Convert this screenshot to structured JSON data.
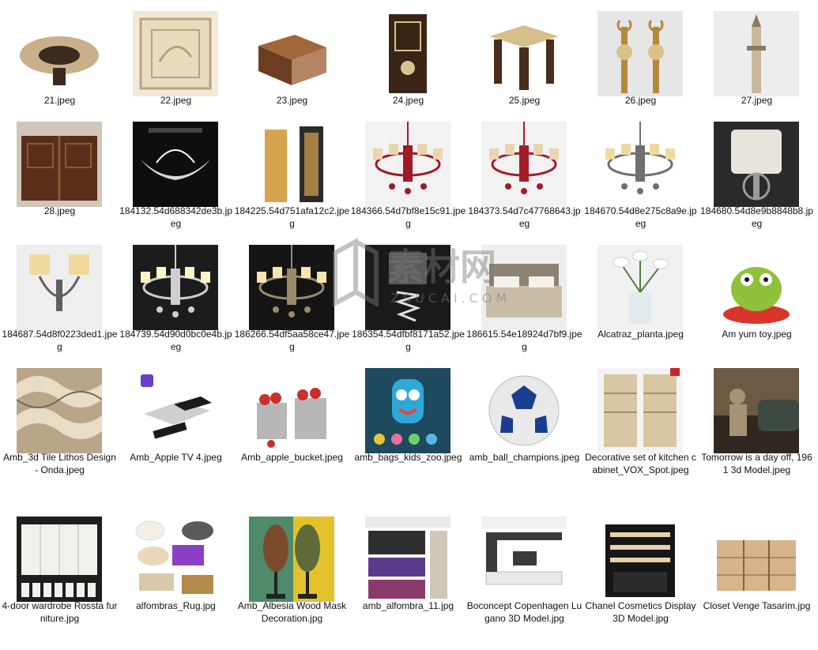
{
  "files": [
    {
      "name": "21.jpeg",
      "icon": "round-table-thumbnail",
      "bg": "#ffffff",
      "c1": "#3b2a1e",
      "c2": "#c9b08a"
    },
    {
      "name": "22.jpeg",
      "icon": "calligraphy-panel-thumbnail",
      "bg": "#f2ead9",
      "c1": "#e8dcc0",
      "c2": "#b9a37a"
    },
    {
      "name": "23.jpeg",
      "icon": "carved-box-thumbnail",
      "bg": "#ffffff",
      "c1": "#6b3e22",
      "c2": "#a0673b"
    },
    {
      "name": "24.jpeg",
      "icon": "wooden-door-thumbnail",
      "bg": "#ffffff",
      "c1": "#3a2416",
      "c2": "#d8c28d"
    },
    {
      "name": "25.jpeg",
      "icon": "side-table-thumbnail",
      "bg": "#ffffff",
      "c1": "#4a2c1a",
      "c2": "#d6bf8a"
    },
    {
      "name": "26.jpeg",
      "icon": "finials-thumbnail",
      "bg": "#e6e6e6",
      "c1": "#b38a3c",
      "c2": "#d9c188"
    },
    {
      "name": "27.jpeg",
      "icon": "minaret-thumbnail",
      "bg": "#ededed",
      "c1": "#c9b89a",
      "c2": "#8c7a5c"
    },
    {
      "name": "28.jpeg",
      "icon": "double-door-thumbnail",
      "bg": "#cfc6b8",
      "c1": "#5a2e1a",
      "c2": "#8a5a36"
    },
    {
      "name": "184132.54d688342de3b.jpeg",
      "icon": "leaf-lamp-thumbnail",
      "bg": "#0e0e0e",
      "c1": "#d9d9d9",
      "c2": "#ffffff"
    },
    {
      "name": "184225.54d751afa12c2.jpeg",
      "icon": "tall-lamps-thumbnail",
      "bg": "#ffffff",
      "c1": "#d6a44e",
      "c2": "#2b2b2b"
    },
    {
      "name": "184366.54d7bf8e15c91.jpeg",
      "icon": "red-chandelier-thumbnail",
      "bg": "#f2f2f2",
      "c1": "#9e1a26",
      "c2": "#e8d5b0"
    },
    {
      "name": "184373.54d7c47768643.jpeg",
      "icon": "red-chandelier-thumbnail",
      "bg": "#f2f2f2",
      "c1": "#a41c2a",
      "c2": "#e8d5b0"
    },
    {
      "name": "184670.54d8e275c8a9e.jpeg",
      "icon": "shade-chandelier-thumbnail",
      "bg": "#ffffff",
      "c1": "#6f6f6f",
      "c2": "#f0d9a0"
    },
    {
      "name": "184680.54d8e9b8848b8.jpeg",
      "icon": "table-lamp-thumbnail",
      "bg": "#2a2a2a",
      "c1": "#e8e4dc",
      "c2": "#9a9a9a"
    },
    {
      "name": "184687.54d8f0223ded1.jpeg",
      "icon": "wall-sconce-thumbnail",
      "bg": "#eeeeee",
      "c1": "#5e5e5e",
      "c2": "#f1d99e"
    },
    {
      "name": "184739.54d90d0bc0e4b.jpeg",
      "icon": "crystal-chandelier-thumbnail",
      "bg": "#1c1c1c",
      "c1": "#cfcfcf",
      "c2": "#fff3c8"
    },
    {
      "name": "186266.54df5aa58ce47.jpeg",
      "icon": "crystal-chandelier-thumbnail",
      "bg": "#141414",
      "c1": "#9a8a6a",
      "c2": "#f7e6b0"
    },
    {
      "name": "186354.54dfbf8171a52.jpeg",
      "icon": "spiral-lamp-thumbnail",
      "bg": "#1a1a1a",
      "c1": "#e0e0e0",
      "c2": "#7a7a7a"
    },
    {
      "name": "186615.54e18924d7bf9.jpeg",
      "icon": "bed-thumbnail",
      "bg": "#eeeeee",
      "c1": "#c9bda8",
      "c2": "#8e8273"
    },
    {
      "name": "Alcatraz_planta.jpeg",
      "icon": "calla-vase-thumbnail",
      "bg": "#f1f1f1",
      "c1": "#ffffff",
      "c2": "#4f7d3a"
    },
    {
      "name": "Am yum toy.jpeg",
      "icon": "green-toy-thumbnail",
      "bg": "#ffffff",
      "c1": "#8fc23a",
      "c2": "#d8362b"
    },
    {
      "name": "Amb_3d Tile Lithos Design - Onda.jpeg",
      "icon": "wave-tile-thumbnail",
      "bg": "#b9a689",
      "c1": "#e9dcc4",
      "c2": "#7a6a52"
    },
    {
      "name": "Amb_Apple TV 4.jpeg",
      "icon": "apple-tv-thumbnail",
      "bg": "#ffffff",
      "c1": "#1a1a1a",
      "c2": "#cfcfcf"
    },
    {
      "name": "Amb_apple_bucket.jpeg",
      "icon": "apple-buckets-thumbnail",
      "bg": "#ffffff",
      "c1": "#c9302c",
      "c2": "#b7b7b7"
    },
    {
      "name": "amb_bags_kids_zoo.jpeg",
      "icon": "kids-backpack-thumbnail",
      "bg": "#1d4a5e",
      "c1": "#2fa8d8",
      "c2": "#e7463a"
    },
    {
      "name": "amb_ball_champions.jpeg",
      "icon": "soccer-ball-thumbnail",
      "bg": "#ffffff",
      "c1": "#1b3d8f",
      "c2": "#e9e9e9"
    },
    {
      "name": "Decorative set of kitchen cabinet_VOX_Spot.jpeg",
      "icon": "kitchen-cabinet-thumbnail",
      "bg": "#f4f4f4",
      "c1": "#d9c7a3",
      "c2": "#6b5a44"
    },
    {
      "name": "Tomorrow is a day off, 1961 3d Model.jpeg",
      "icon": "vintage-scene-thumbnail",
      "bg": "#6d5a45",
      "c1": "#2e2820",
      "c2": "#a89276"
    },
    {
      "name": "4-door wardrobe Rossta furniture.jpg",
      "icon": "wardrobe-thumbnail",
      "bg": "#1e1e1e",
      "c1": "#f2f0ea",
      "c2": "#bdb9ae"
    },
    {
      "name": "alfombras_Rug.jpg",
      "icon": "rugs-thumbnail",
      "bg": "#ffffff",
      "c1": "#8a3fc4",
      "c2": "#d9c9a8"
    },
    {
      "name": "Amb_Albesia Wood Mask Decoration.jpg",
      "icon": "wood-masks-thumbnail",
      "bg": "#4f8a6a",
      "c1": "#7a4a2a",
      "c2": "#e3c22b"
    },
    {
      "name": "amb_alfombra_11.jpg",
      "icon": "rug-samples-thumbnail",
      "bg": "#ffffff",
      "c1": "#5a3a8a",
      "c2": "#2e2e2e"
    },
    {
      "name": "Boconcept Copenhagen Lugano 3D Model.jpg",
      "icon": "media-wall-thumbnail",
      "bg": "#ffffff",
      "c1": "#3a3a3a",
      "c2": "#e9e9e9"
    },
    {
      "name": "Chanel Cosmetics Display 3D Model.jpg",
      "icon": "cosmetics-display-thumbnail",
      "bg": "#ffffff",
      "c1": "#161616",
      "c2": "#e6d3a8"
    },
    {
      "name": "Closet Venge Tasarim.jpg",
      "icon": "closet-thumbnail",
      "bg": "#ffffff",
      "c1": "#d6b58a",
      "c2": "#8a5f36"
    }
  ],
  "watermark": {
    "icon": "zsucai-watermark-icon",
    "text": "ZSUCAI.COM",
    "brand": "素材网",
    "color": "#7a7a7a"
  }
}
